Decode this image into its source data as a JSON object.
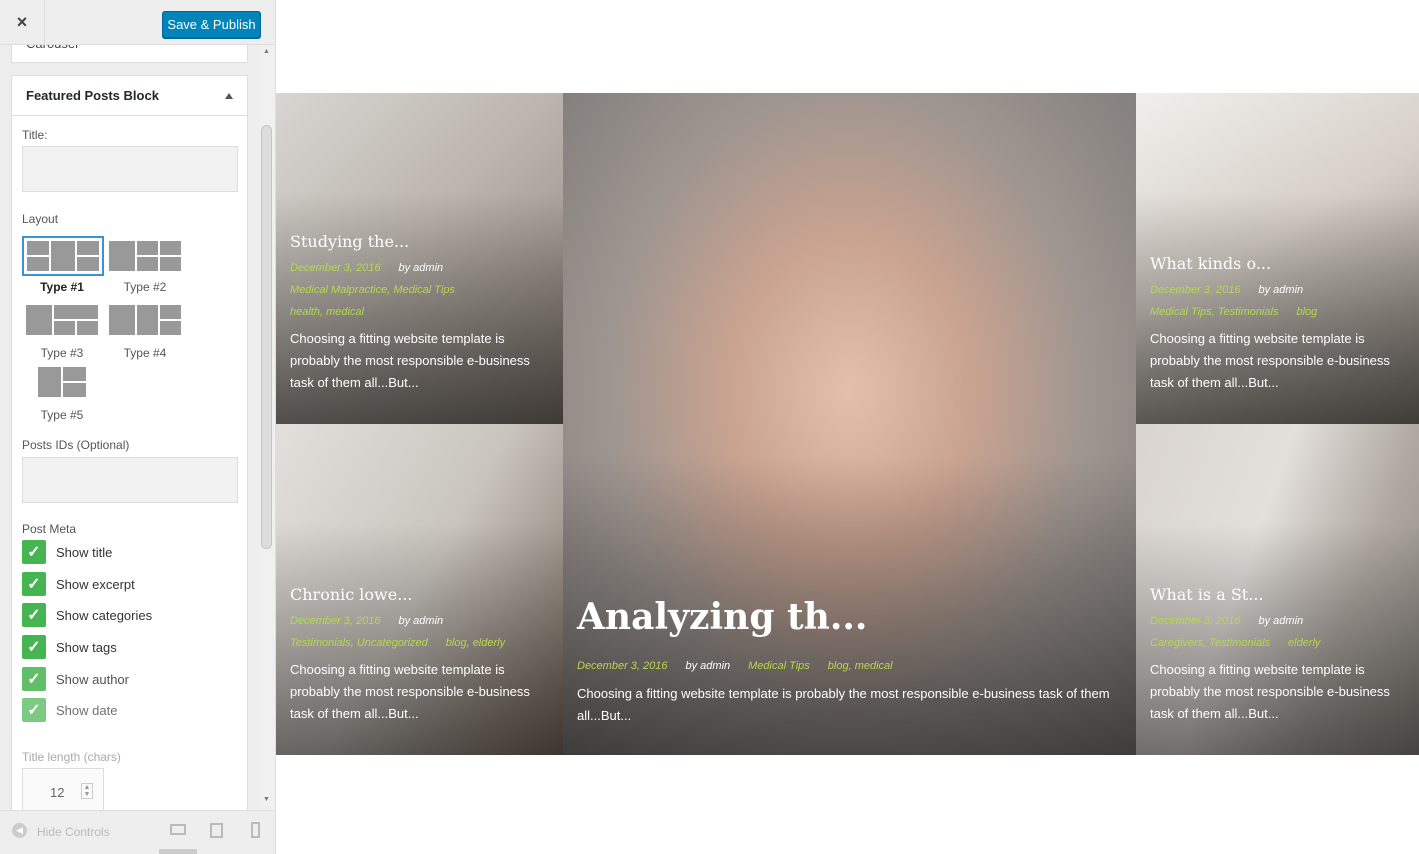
{
  "toolbar": {
    "close_glyph": "×",
    "publish_label": "Save & Publish"
  },
  "carousel_label": "Carousel",
  "panel": {
    "title": "Featured Posts Block"
  },
  "fields": {
    "title_label": "Title:",
    "layout_label": "Layout",
    "posts_ids_label": "Posts IDs (Optional)",
    "post_meta_label": "Post Meta",
    "title_length_label": "Title length (chars)",
    "title_length_value": "12"
  },
  "layouts": [
    {
      "label": "Type #1",
      "selected": true
    },
    {
      "label": "Type #2"
    },
    {
      "label": "Type #3"
    },
    {
      "label": "Type #4"
    },
    {
      "label": "Type #5"
    }
  ],
  "post_meta": [
    {
      "label": "Show title",
      "checked": true
    },
    {
      "label": "Show excerpt",
      "checked": true
    },
    {
      "label": "Show categories",
      "checked": true
    },
    {
      "label": "Show tags",
      "checked": true
    },
    {
      "label": "Show author",
      "checked": true
    },
    {
      "label": "Show date",
      "checked": true
    }
  ],
  "footer": {
    "hide_controls": "Hide Controls"
  },
  "colors": {
    "accent": "#0085ba",
    "check": "#46b450",
    "meta_green": "#b6d94c"
  },
  "posts": [
    {
      "title": "Studying the...",
      "date": "December 3, 2016",
      "author": "by admin",
      "categories": "Medical Malpractice, Medical Tips",
      "tags": "health, medical",
      "excerpt": "Choosing a fitting website template is probably the most responsible e-business task of them all...But..."
    },
    {
      "title": "Analyzing th...",
      "date": "December 3, 2016",
      "author": "by admin",
      "categories": "Medical Tips",
      "tags": "blog, medical",
      "excerpt": "Choosing a fitting website template is probably the most responsible e-business task of them all...But..."
    },
    {
      "title": "What kinds o...",
      "date": "December 3, 2016",
      "author": "by admin",
      "categories": "Medical Tips, Testimonials",
      "tags": "blog",
      "excerpt": "Choosing a fitting website template is probably the most responsible e-business task of them all...But..."
    },
    {
      "title": "Chronic lowe...",
      "date": "December 3, 2016",
      "author": "by admin",
      "categories": "Testimonials, Uncategorized",
      "tags": "blog, elderly",
      "excerpt": "Choosing a fitting website template is probably the most responsible e-business task of them all...But..."
    },
    {
      "title": "What is a St...",
      "date": "December 3, 2016",
      "author": "by admin",
      "categories": "Caregivers, Testimonials",
      "tags": "elderly",
      "excerpt": "Choosing a fitting website template is probably the most responsible e-business task of them all...But..."
    }
  ]
}
